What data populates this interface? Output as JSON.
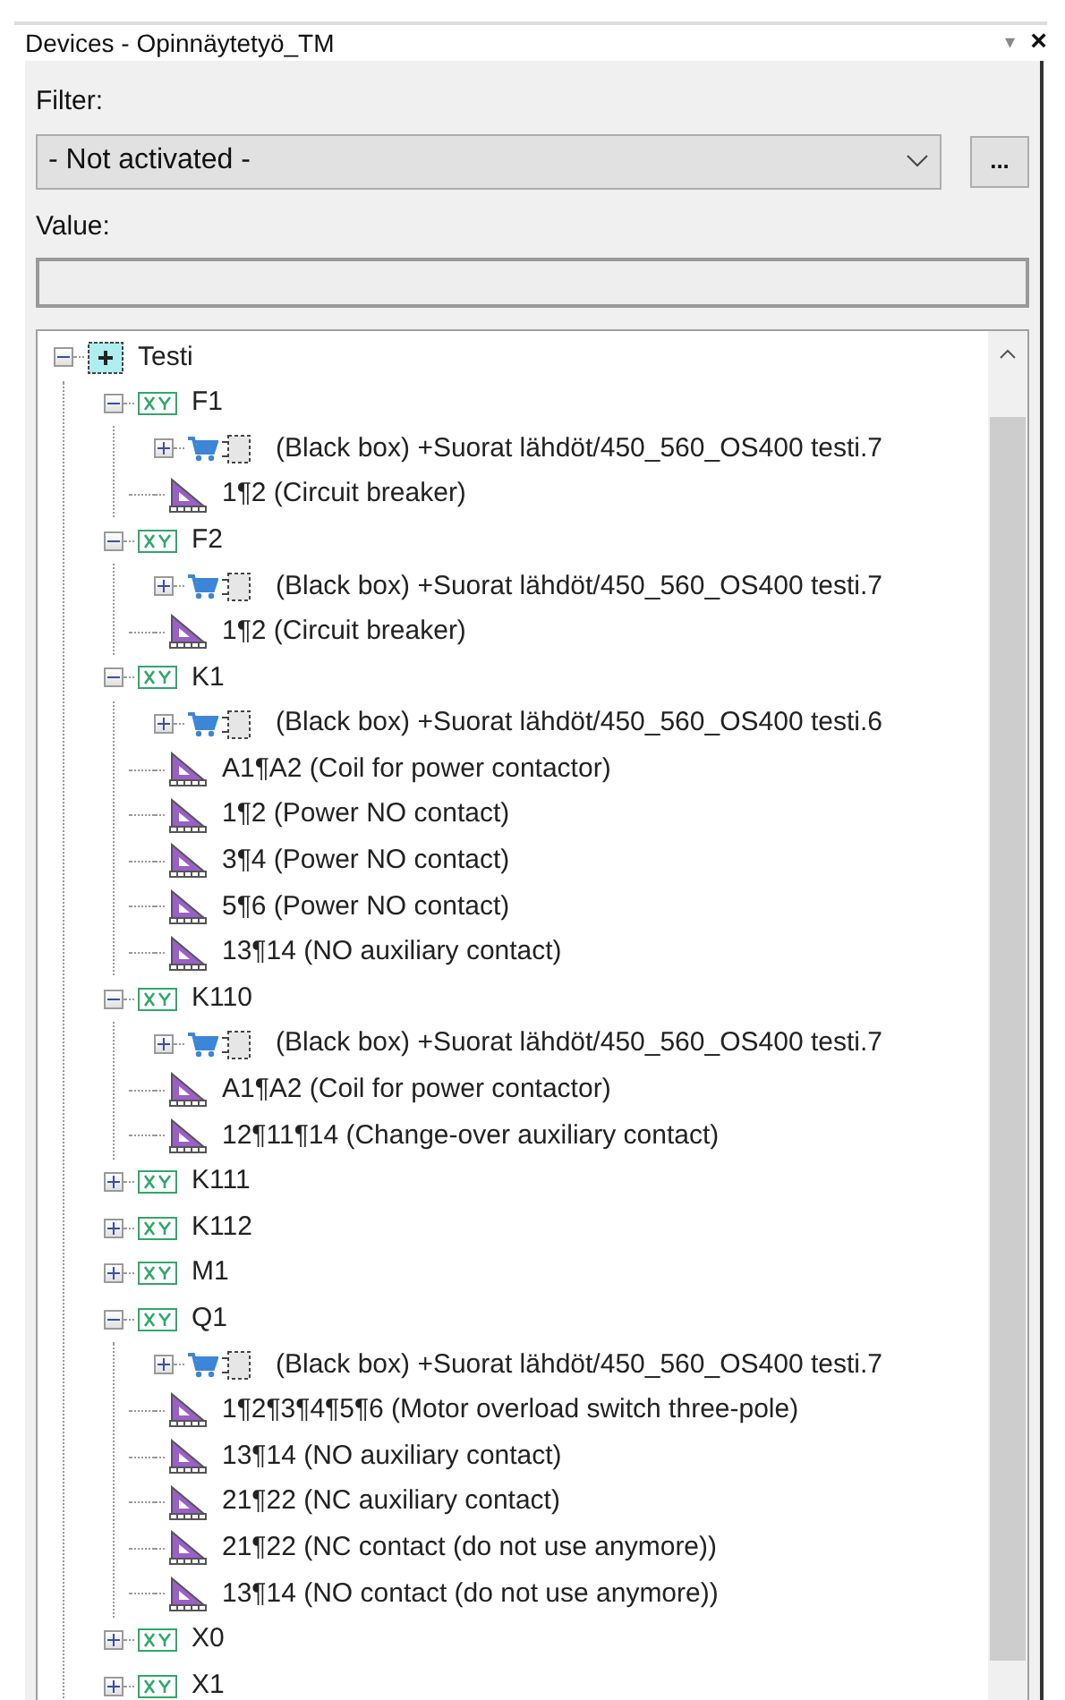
{
  "panel": {
    "title": "Devices - Opinnäytetyö_TM",
    "menu_glyph": "▾",
    "close_glyph": "×"
  },
  "filter": {
    "label": "Filter:",
    "value": "- Not activated -",
    "more_button": "..."
  },
  "value": {
    "label": "Value:"
  },
  "tree": [
    {
      "kind": "root",
      "label": "Testi",
      "expanded": true,
      "children": [
        {
          "kind": "device",
          "label": "F1",
          "expanded": true,
          "children": [
            {
              "kind": "blackbox",
              "label": "(Black box) +Suorat lähdöt/450_560_OS400 testi.7",
              "expanded": false
            },
            {
              "kind": "function",
              "label": "1¶2 (Circuit breaker)"
            }
          ]
        },
        {
          "kind": "device",
          "label": "F2",
          "expanded": true,
          "children": [
            {
              "kind": "blackbox",
              "label": "(Black box) +Suorat lähdöt/450_560_OS400 testi.7",
              "expanded": false
            },
            {
              "kind": "function",
              "label": "1¶2 (Circuit breaker)"
            }
          ]
        },
        {
          "kind": "device",
          "label": "K1",
          "expanded": true,
          "children": [
            {
              "kind": "blackbox",
              "label": "(Black box) +Suorat lähdöt/450_560_OS400 testi.6",
              "expanded": false
            },
            {
              "kind": "function",
              "label": "A1¶A2 (Coil for power contactor)"
            },
            {
              "kind": "function",
              "label": "1¶2 (Power NO contact)"
            },
            {
              "kind": "function",
              "label": "3¶4 (Power NO contact)"
            },
            {
              "kind": "function",
              "label": "5¶6 (Power NO contact)"
            },
            {
              "kind": "function",
              "label": "13¶14 (NO auxiliary contact)"
            }
          ]
        },
        {
          "kind": "device",
          "label": "K110",
          "expanded": true,
          "children": [
            {
              "kind": "blackbox",
              "label": "(Black box) +Suorat lähdöt/450_560_OS400 testi.7",
              "expanded": false
            },
            {
              "kind": "function",
              "label": "A1¶A2 (Coil for power contactor)"
            },
            {
              "kind": "function",
              "label": "12¶11¶14 (Change-over auxiliary contact)"
            }
          ]
        },
        {
          "kind": "device",
          "label": "K111",
          "expanded": false
        },
        {
          "kind": "device",
          "label": "K112",
          "expanded": false
        },
        {
          "kind": "device",
          "label": "M1",
          "expanded": false
        },
        {
          "kind": "device",
          "label": "Q1",
          "expanded": true,
          "children": [
            {
              "kind": "blackbox",
              "label": "(Black box) +Suorat lähdöt/450_560_OS400 testi.7",
              "expanded": false
            },
            {
              "kind": "function",
              "label": "1¶2¶3¶4¶5¶6 (Motor overload switch three-pole)"
            },
            {
              "kind": "function",
              "label": "13¶14 (NO auxiliary contact)"
            },
            {
              "kind": "function",
              "label": "21¶22 (NC auxiliary contact)"
            },
            {
              "kind": "function",
              "label": "21¶22 (NC contact (do not use anymore))"
            },
            {
              "kind": "function",
              "label": "13¶14 (NO contact (do not use anymore))"
            }
          ]
        },
        {
          "kind": "device",
          "label": "X0",
          "expanded": false
        },
        {
          "kind": "device",
          "label": "X1",
          "expanded": false
        }
      ]
    }
  ]
}
